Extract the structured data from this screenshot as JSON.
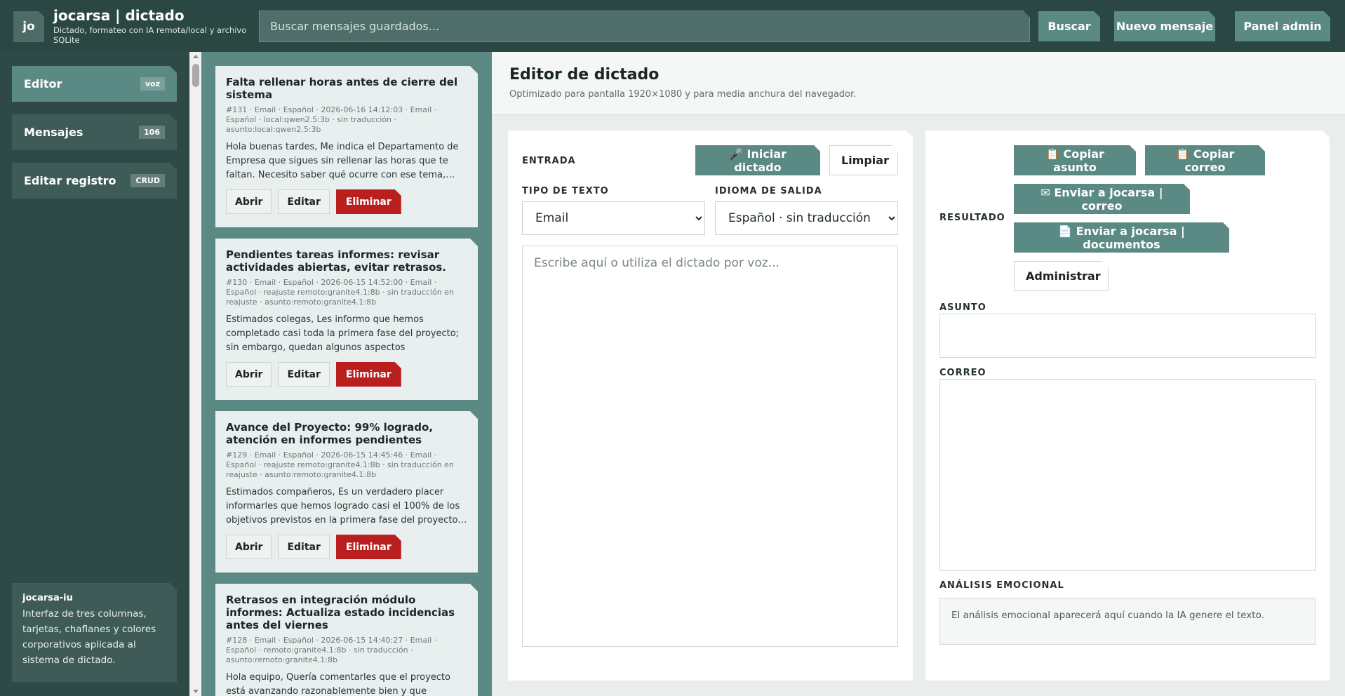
{
  "header": {
    "avatar": "jo",
    "title": "jocarsa | dictado",
    "subtitle": "Dictado, formateo con IA remota/local y archivo SQLite",
    "search_placeholder": "Buscar mensajes guardados...",
    "search_button": "Buscar",
    "new_message_button": "Nuevo mensaje",
    "admin_button": "Panel admin"
  },
  "sidebar": {
    "items": [
      {
        "label": "Editor",
        "badge": "voz",
        "active": true
      },
      {
        "label": "Mensajes",
        "badge": "106",
        "active": false
      },
      {
        "label": "Editar registro",
        "badge": "CRUD",
        "active": false
      }
    ],
    "card": {
      "title": "jocarsa-iu",
      "text": "Interfaz de tres columnas, tarjetas, chaflanes y colores corporativos aplicada al sistema de dictado."
    }
  },
  "messages": {
    "actions": {
      "open": "Abrir",
      "edit": "Editar",
      "delete": "Eliminar"
    },
    "items": [
      {
        "title": "Falta rellenar horas antes de cierre del sistema",
        "meta": "#131 · Email · Español · 2026-06-16 14:12:03 · Email · Español · local:qwen2.5:3b · sin traducción · asunto:local:qwen2.5:3b",
        "body": "Hola buenas tardes, Me indica el Departamento de Empresa que sigues sin rellenar las horas que te faltan. Necesito saber qué ocurre con ese tema,…"
      },
      {
        "title": "Pendientes tareas informes: revisar actividades abiertas, evitar retrasos.",
        "meta": "#130 · Email · Español · 2026-06-15 14:52:00 · Email · Español · reajuste remoto:granite4.1:8b · sin traducción en reajuste · asunto:remoto:granite4.1:8b",
        "body": "Estimados colegas, Les informo que hemos completado casi toda la primera fase del proyecto; sin embargo, quedan algunos aspectos pendientes…"
      },
      {
        "title": "Avance del Proyecto: 99% logrado, atención en informes pendientes",
        "meta": "#129 · Email · Español · 2026-06-15 14:45:46 · Email · Español · reajuste remoto:granite4.1:8b · sin traducción en reajuste · asunto:remoto:granite4.1:8b",
        "body": "Estimados compañeros, Es un verdadero placer informarles que hemos logrado casi el 100% de los objetivos previstos en la primera fase del proyecto…"
      },
      {
        "title": "Retrasos en integración módulo informes: Actualiza estado incidencias antes del viernes",
        "meta": "#128 · Email · Español · 2026-06-15 14:40:27 · Email · Español · remoto:granite4.1:8b · sin traducción · asunto:remoto:granite4.1:8b",
        "body": "Hola equipo, Quería comentarles que el proyecto está avanzando razonablemente bien y que hemos…"
      }
    ]
  },
  "main": {
    "title": "Editor de dictado",
    "subtitle": "Optimizado para pantalla 1920×1080 y para media anchura del navegador."
  },
  "input_panel": {
    "label": "ENTRADA",
    "start_dictation": "🎤 Iniciar dictado",
    "clear": "Limpiar",
    "text_type_label": "TIPO DE TEXTO",
    "text_type_value": "Email",
    "output_lang_label": "IDIOMA DE SALIDA",
    "output_lang_value": "Español · sin traducción",
    "textarea_placeholder": "Escribe aquí o utiliza el dictado por voz..."
  },
  "result_panel": {
    "label": "RESULTADO",
    "copy_subject": "📋 Copiar asunto",
    "copy_email": "📋 Copiar correo",
    "send_mail": "✉ Enviar a jocarsa | correo",
    "send_docs": "📄 Enviar a jocarsa | documentos",
    "manage": "Administrar",
    "subject_label": "ASUNTO",
    "email_label": "CORREO",
    "emotion_label": "ANÁLISIS EMOCIONAL",
    "emotion_text": "El análisis emocional aparecerá aquí cuando la IA genere el texto."
  }
}
